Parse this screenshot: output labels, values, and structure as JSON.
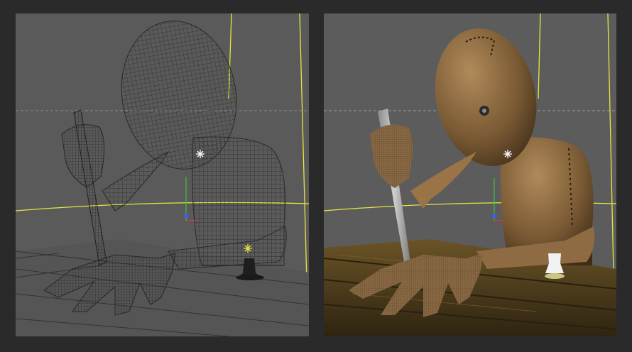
{
  "viewports": [
    {
      "id": "left",
      "shading_mode": "wireframe",
      "icons": [
        "light-icon",
        "light-icon",
        "transform-gizmo-icon"
      ],
      "colors": {
        "background": "#5a5a5a",
        "wire": "#2c2c2c",
        "horizon": "#e6e640"
      }
    },
    {
      "id": "right",
      "shading_mode": "textured",
      "icons": [
        "light-icon",
        "transform-gizmo-icon"
      ],
      "colors": {
        "background": "#5c5c5c",
        "burlap": "#8a6a45",
        "table": "#4a3a1e"
      }
    }
  ]
}
